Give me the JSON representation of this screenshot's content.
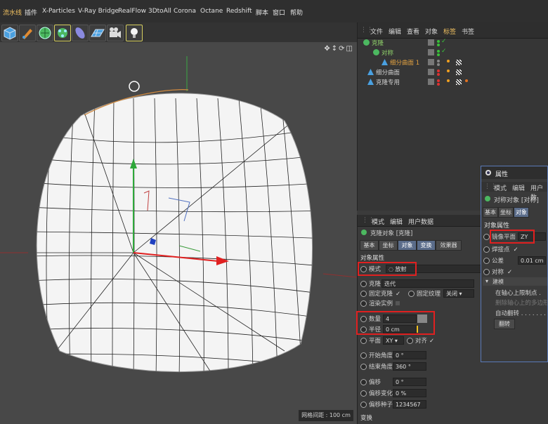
{
  "menubar": {
    "items": [
      "流水线",
      "插件",
      "X-Particles",
      "V-Ray Bridge",
      "RealFlow",
      "3DtoAll",
      "Corona",
      "Octane",
      "Redshift",
      "脚本",
      "窗口",
      "帮助"
    ]
  },
  "toolbar": {
    "buttons": [
      "cube-icon",
      "pen-icon",
      "subdivision-icon",
      "cloner-icon",
      "deformer-icon",
      "floor-icon",
      "camera-icon",
      "light-icon"
    ]
  },
  "object_manager": {
    "tabs": [
      "文件",
      "编辑",
      "查看",
      "对象",
      "标签",
      "书签"
    ],
    "rows": [
      {
        "label": "克隆",
        "color": "#8fd06a"
      },
      {
        "label": "对称",
        "color": "#8fd06a"
      },
      {
        "label": "细分曲面 1",
        "color": "#e0a040"
      },
      {
        "label": "细分曲面",
        "color": "#cfcfcf"
      },
      {
        "label": "克隆专用",
        "color": "#cfcfcf"
      }
    ]
  },
  "viewport": {
    "grid_label": "网格间距 : 100 cm"
  },
  "attributes": {
    "tabs": [
      "模式",
      "编辑",
      "用户数据"
    ],
    "object_title": "克隆对象 [克隆]",
    "subtabs": [
      "基本",
      "坐标",
      "对象",
      "变换",
      "效果器"
    ],
    "section": "对象属性",
    "mode_label": "模式",
    "mode_value": "放射",
    "clone_label": "克隆",
    "clone_value": "迭代",
    "fixed_clone_label": "固定克隆",
    "fixed_texture_label": "固定纹理",
    "fixed_texture_value": "关闭",
    "render_instances_label": "渲染实例",
    "count_label": "数量",
    "count_value": "4",
    "radius_label": "半径",
    "radius_value": "0 cm",
    "plane_label": "平面",
    "plane_value": "XY",
    "align_label": "对齐",
    "start_angle_label": "开始角度",
    "start_angle_value": "0 °",
    "end_angle_label": "结束角度",
    "end_angle_value": "360 °",
    "offset_label": "偏移",
    "offset_value": "0 °",
    "offset_var_label": "偏移变化",
    "offset_var_value": "0 %",
    "offset_seed_label": "偏移种子",
    "offset_seed_value": "1234567",
    "footer": "变换"
  },
  "float_window": {
    "title": "属性",
    "tabs": [
      "模式",
      "编辑",
      "用户数"
    ],
    "object_title": "对称对象 [对称]",
    "subtabs": [
      "基本",
      "坐标",
      "对象"
    ],
    "section": "对象属性",
    "mirror_label": "镜像平面",
    "mirror_value": "ZY",
    "weld_label": "焊接点",
    "tolerance_label": "公差",
    "tolerance_value": "0.01 cm",
    "symmetry_label": "对称",
    "advanced_label": "建模",
    "item1": "在轴心上限制点 .",
    "item2": "删除轴心上的多边形",
    "item3": "自动翻转 . . . . . . .",
    "flip_button": "翻转"
  }
}
